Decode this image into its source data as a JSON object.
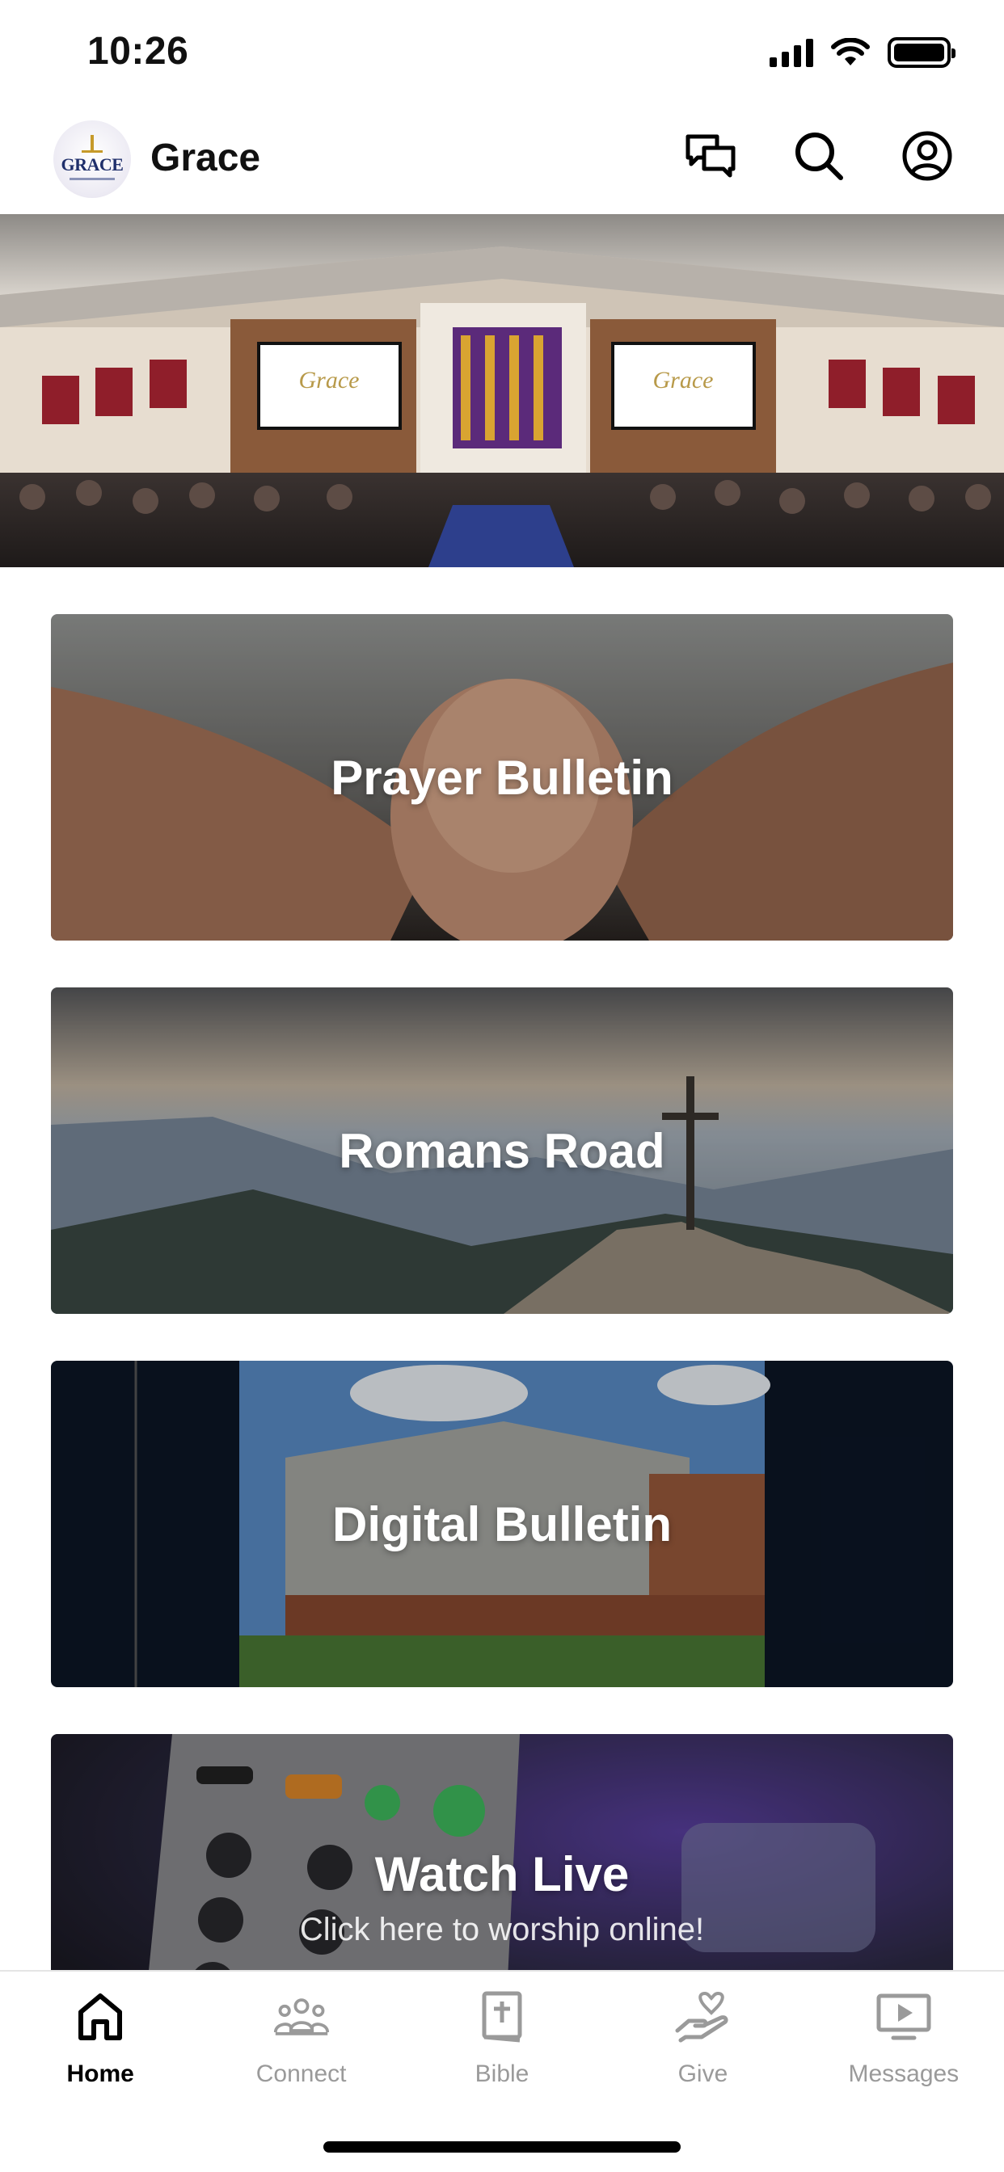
{
  "status_bar": {
    "time": "10:26"
  },
  "header": {
    "title": "Grace",
    "logo_text": "GRACE",
    "icons": [
      "chat-bubbles-icon",
      "search-icon",
      "profile-icon"
    ]
  },
  "hero": {
    "alt": "Church sanctuary worship service"
  },
  "cards": [
    {
      "title": "Prayer Bulletin",
      "subtitle": ""
    },
    {
      "title": "Romans Road",
      "subtitle": ""
    },
    {
      "title": "Digital Bulletin",
      "subtitle": ""
    },
    {
      "title": "Watch Live",
      "subtitle": "Click here to worship online!"
    }
  ],
  "tab_bar": {
    "items": [
      {
        "label": "Home",
        "icon": "home-icon",
        "active": true
      },
      {
        "label": "Connect",
        "icon": "people-icon",
        "active": false
      },
      {
        "label": "Bible",
        "icon": "bible-icon",
        "active": false
      },
      {
        "label": "Give",
        "icon": "give-hand-icon",
        "active": false
      },
      {
        "label": "Messages",
        "icon": "play-screen-icon",
        "active": false
      }
    ]
  },
  "colors": {
    "active_tab": "#000000",
    "inactive_tab": "#9a9a9a",
    "card_text": "#ffffff"
  }
}
